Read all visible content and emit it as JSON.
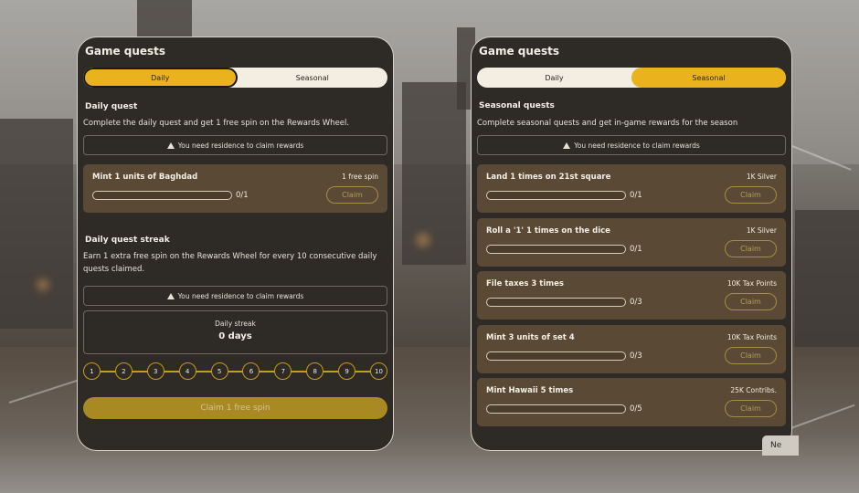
{
  "left_panel": {
    "title": "Game quests",
    "tabs": [
      "Daily",
      "Seasonal"
    ],
    "active_tab": "Daily",
    "daily_quest": {
      "title": "Daily quest",
      "description": "Complete the daily quest and get 1 free spin on the Rewards Wheel.",
      "notice": "You need residence to claim rewards",
      "quest": {
        "name": "Mint 1 units of Baghdad",
        "progress": "0/1",
        "progress_fraction": 0,
        "reward": "1 free spin",
        "claim_label": "Claim"
      }
    },
    "streak": {
      "title": "Daily quest streak",
      "description": "Earn 1 extra free spin on the Rewards Wheel for every 10 consecutive daily quests claimed.",
      "notice": "You need residence to claim rewards",
      "label": "Daily streak",
      "value": "0 days",
      "steps": [
        "1",
        "2",
        "3",
        "4",
        "5",
        "6",
        "7",
        "8",
        "9",
        "10"
      ]
    },
    "claim_spin_label": "Claim 1 free spin"
  },
  "right_panel": {
    "title": "Game quests",
    "tabs": [
      "Daily",
      "Seasonal"
    ],
    "active_tab": "Seasonal",
    "section_title": "Seasonal quests",
    "description": "Complete seasonal quests and get in-game rewards for the season",
    "notice": "You need residence to claim rewards",
    "quests": [
      {
        "name": "Land 1 times on 21st square",
        "progress": "0/1",
        "progress_fraction": 0,
        "reward": "1K Silver",
        "claim_label": "Claim"
      },
      {
        "name": "Roll a '1' 1 times on the dice",
        "progress": "0/1",
        "progress_fraction": 0,
        "reward": "1K Silver",
        "claim_label": "Claim"
      },
      {
        "name": "File taxes 3 times",
        "progress": "0/3",
        "progress_fraction": 0,
        "reward": "10K Tax Points",
        "claim_label": "Claim"
      },
      {
        "name": "Mint 3 units of set 4",
        "progress": "0/3",
        "progress_fraction": 0,
        "reward": "10K Tax Points",
        "claim_label": "Claim"
      },
      {
        "name": "Mint Hawaii 5 times",
        "progress": "0/5",
        "progress_fraction": 0,
        "reward": "25K Contribs.",
        "claim_label": "Claim"
      }
    ]
  },
  "next_button_label": "Ne",
  "colors": {
    "accent": "#eab31d",
    "panel_bg": "#2e2a25",
    "quest_bg": "#5a4a35"
  },
  "icons": {
    "notice": "warning-icon"
  }
}
